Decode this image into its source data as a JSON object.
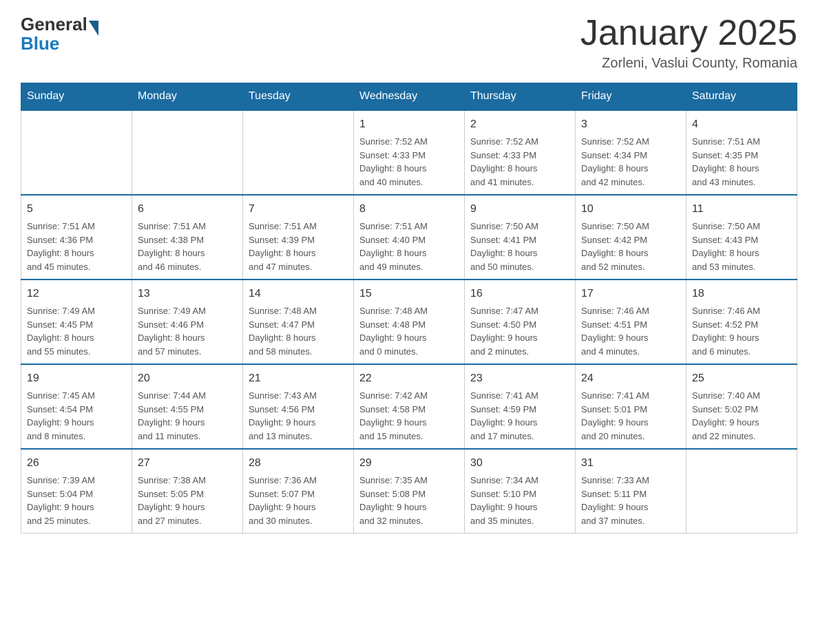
{
  "header": {
    "logo_general": "General",
    "logo_blue": "Blue",
    "title": "January 2025",
    "subtitle": "Zorleni, Vaslui County, Romania"
  },
  "days_of_week": [
    "Sunday",
    "Monday",
    "Tuesday",
    "Wednesday",
    "Thursday",
    "Friday",
    "Saturday"
  ],
  "weeks": [
    [
      {
        "day": "",
        "info": ""
      },
      {
        "day": "",
        "info": ""
      },
      {
        "day": "",
        "info": ""
      },
      {
        "day": "1",
        "info": "Sunrise: 7:52 AM\nSunset: 4:33 PM\nDaylight: 8 hours\nand 40 minutes."
      },
      {
        "day": "2",
        "info": "Sunrise: 7:52 AM\nSunset: 4:33 PM\nDaylight: 8 hours\nand 41 minutes."
      },
      {
        "day": "3",
        "info": "Sunrise: 7:52 AM\nSunset: 4:34 PM\nDaylight: 8 hours\nand 42 minutes."
      },
      {
        "day": "4",
        "info": "Sunrise: 7:51 AM\nSunset: 4:35 PM\nDaylight: 8 hours\nand 43 minutes."
      }
    ],
    [
      {
        "day": "5",
        "info": "Sunrise: 7:51 AM\nSunset: 4:36 PM\nDaylight: 8 hours\nand 45 minutes."
      },
      {
        "day": "6",
        "info": "Sunrise: 7:51 AM\nSunset: 4:38 PM\nDaylight: 8 hours\nand 46 minutes."
      },
      {
        "day": "7",
        "info": "Sunrise: 7:51 AM\nSunset: 4:39 PM\nDaylight: 8 hours\nand 47 minutes."
      },
      {
        "day": "8",
        "info": "Sunrise: 7:51 AM\nSunset: 4:40 PM\nDaylight: 8 hours\nand 49 minutes."
      },
      {
        "day": "9",
        "info": "Sunrise: 7:50 AM\nSunset: 4:41 PM\nDaylight: 8 hours\nand 50 minutes."
      },
      {
        "day": "10",
        "info": "Sunrise: 7:50 AM\nSunset: 4:42 PM\nDaylight: 8 hours\nand 52 minutes."
      },
      {
        "day": "11",
        "info": "Sunrise: 7:50 AM\nSunset: 4:43 PM\nDaylight: 8 hours\nand 53 minutes."
      }
    ],
    [
      {
        "day": "12",
        "info": "Sunrise: 7:49 AM\nSunset: 4:45 PM\nDaylight: 8 hours\nand 55 minutes."
      },
      {
        "day": "13",
        "info": "Sunrise: 7:49 AM\nSunset: 4:46 PM\nDaylight: 8 hours\nand 57 minutes."
      },
      {
        "day": "14",
        "info": "Sunrise: 7:48 AM\nSunset: 4:47 PM\nDaylight: 8 hours\nand 58 minutes."
      },
      {
        "day": "15",
        "info": "Sunrise: 7:48 AM\nSunset: 4:48 PM\nDaylight: 9 hours\nand 0 minutes."
      },
      {
        "day": "16",
        "info": "Sunrise: 7:47 AM\nSunset: 4:50 PM\nDaylight: 9 hours\nand 2 minutes."
      },
      {
        "day": "17",
        "info": "Sunrise: 7:46 AM\nSunset: 4:51 PM\nDaylight: 9 hours\nand 4 minutes."
      },
      {
        "day": "18",
        "info": "Sunrise: 7:46 AM\nSunset: 4:52 PM\nDaylight: 9 hours\nand 6 minutes."
      }
    ],
    [
      {
        "day": "19",
        "info": "Sunrise: 7:45 AM\nSunset: 4:54 PM\nDaylight: 9 hours\nand 8 minutes."
      },
      {
        "day": "20",
        "info": "Sunrise: 7:44 AM\nSunset: 4:55 PM\nDaylight: 9 hours\nand 11 minutes."
      },
      {
        "day": "21",
        "info": "Sunrise: 7:43 AM\nSunset: 4:56 PM\nDaylight: 9 hours\nand 13 minutes."
      },
      {
        "day": "22",
        "info": "Sunrise: 7:42 AM\nSunset: 4:58 PM\nDaylight: 9 hours\nand 15 minutes."
      },
      {
        "day": "23",
        "info": "Sunrise: 7:41 AM\nSunset: 4:59 PM\nDaylight: 9 hours\nand 17 minutes."
      },
      {
        "day": "24",
        "info": "Sunrise: 7:41 AM\nSunset: 5:01 PM\nDaylight: 9 hours\nand 20 minutes."
      },
      {
        "day": "25",
        "info": "Sunrise: 7:40 AM\nSunset: 5:02 PM\nDaylight: 9 hours\nand 22 minutes."
      }
    ],
    [
      {
        "day": "26",
        "info": "Sunrise: 7:39 AM\nSunset: 5:04 PM\nDaylight: 9 hours\nand 25 minutes."
      },
      {
        "day": "27",
        "info": "Sunrise: 7:38 AM\nSunset: 5:05 PM\nDaylight: 9 hours\nand 27 minutes."
      },
      {
        "day": "28",
        "info": "Sunrise: 7:36 AM\nSunset: 5:07 PM\nDaylight: 9 hours\nand 30 minutes."
      },
      {
        "day": "29",
        "info": "Sunrise: 7:35 AM\nSunset: 5:08 PM\nDaylight: 9 hours\nand 32 minutes."
      },
      {
        "day": "30",
        "info": "Sunrise: 7:34 AM\nSunset: 5:10 PM\nDaylight: 9 hours\nand 35 minutes."
      },
      {
        "day": "31",
        "info": "Sunrise: 7:33 AM\nSunset: 5:11 PM\nDaylight: 9 hours\nand 37 minutes."
      },
      {
        "day": "",
        "info": ""
      }
    ]
  ]
}
